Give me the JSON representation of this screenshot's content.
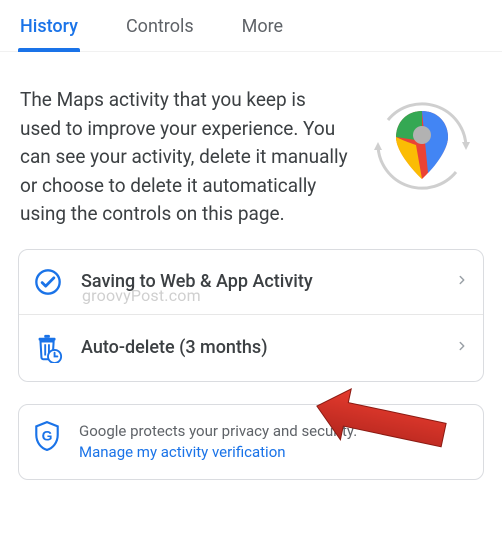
{
  "tabs": {
    "history": "History",
    "controls": "Controls",
    "more": "More"
  },
  "hero": {
    "text": "The Maps activity that you keep is used to improve your experience. You can see your activity, delete it manually or choose to delete it automatically using the controls on this page."
  },
  "watermark": "groovyPost.com",
  "rows": {
    "saving": {
      "label": "Saving to Web & App Activity",
      "icon": "check-circle"
    },
    "autodelete": {
      "label": "Auto-delete (3 months)",
      "icon": "trash-clock"
    }
  },
  "security": {
    "text": "Google protects your privacy and security.",
    "link": "Manage my activity verification"
  },
  "colors": {
    "accent": "#1a73e8",
    "text": "#3c4043",
    "muted": "#5f6368",
    "border": "#dadce0"
  }
}
